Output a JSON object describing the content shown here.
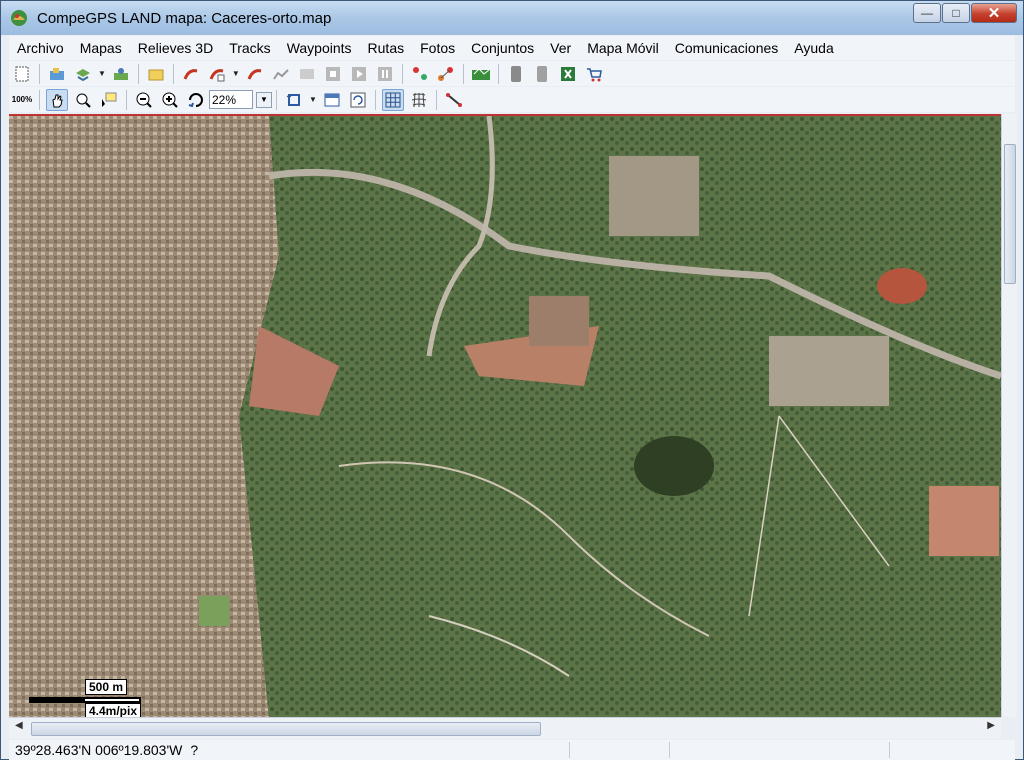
{
  "window": {
    "title": "CompeGPS LAND mapa: Caceres-orto.map"
  },
  "menu": [
    "Archivo",
    "Mapas",
    "Relieves 3D",
    "Tracks",
    "Waypoints",
    "Rutas",
    "Fotos",
    "Conjuntos",
    "Ver",
    "Mapa Móvil",
    "Comunicaciones",
    "Ayuda"
  ],
  "toolbar": {
    "zoom_value": "22%",
    "zoom_reset_label": "100%"
  },
  "map": {
    "scale_distance": "500 m",
    "scale_resolution": "4.4m/pix"
  },
  "status": {
    "coordinates": "39º28.463'N 006º19.803'W",
    "hint": "?"
  },
  "colors": {
    "titlebar": "#a9c6e6",
    "accent_border": "#b33333",
    "map_green": "#4f6b3a",
    "urban": "#a8937a"
  },
  "icons": [
    "app-icon",
    "new-map-icon",
    "open-map-icon",
    "map-layers-icon",
    "satellite-icon",
    "folder-icon",
    "track-open-icon",
    "track-new-icon",
    "track-edit-icon",
    "track-profile-icon",
    "stop-icon",
    "play-icon",
    "pause-icon",
    "waypoint-icon",
    "route-icon",
    "3d-view-icon",
    "gps-send-icon",
    "gps-receive-icon",
    "excel-icon",
    "shop-icon",
    "zoom-100-icon",
    "pan-hand-icon",
    "zoom-tool-icon",
    "select-tool-icon",
    "zoom-out-icon",
    "zoom-in-icon",
    "zoom-all-icon",
    "rotate-icon",
    "layer-icon",
    "refresh-icon",
    "grid-icon",
    "geo-grid-icon",
    "measure-icon"
  ]
}
